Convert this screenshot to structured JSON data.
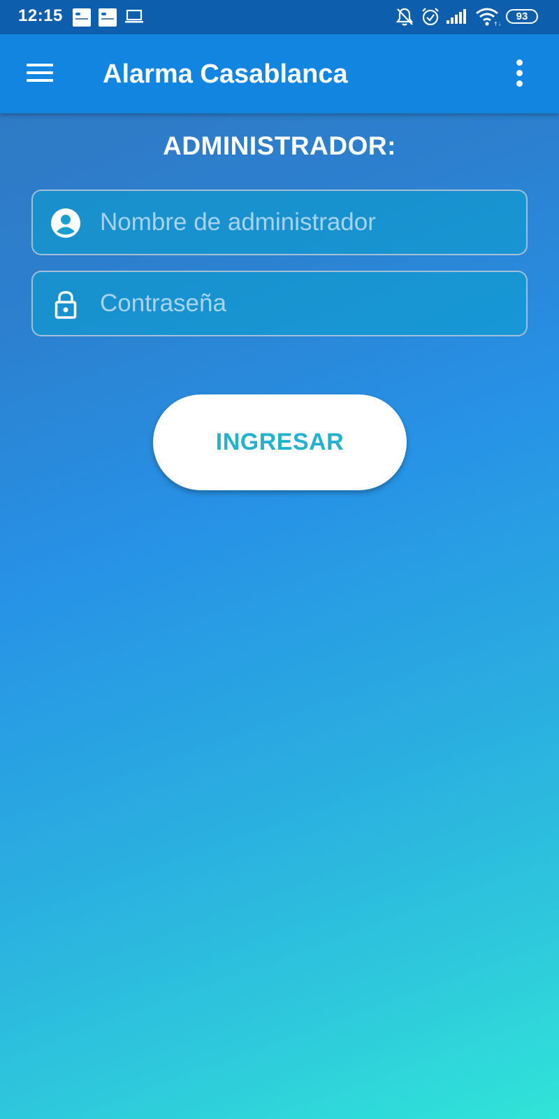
{
  "status_bar": {
    "time": "12:15",
    "battery_level": "93",
    "icons": [
      "app-notification-icon",
      "app-notification-icon",
      "laptop-icon",
      "bell-off-icon",
      "alarm-clock-icon",
      "cell-signal-icon",
      "wifi-icon",
      "battery-icon"
    ]
  },
  "app_bar": {
    "title": "Alarma Casablanca",
    "menu_icon": "hamburger-menu-icon",
    "overflow_icon": "more-vertical-icon",
    "color": "#1285e0"
  },
  "login": {
    "heading": "ADMINISTRADOR:",
    "username_placeholder": "Nombre de administrador",
    "username_value": "",
    "username_icon": "account-circle-icon",
    "password_placeholder": "Contraseña",
    "password_value": "",
    "password_icon": "lock-icon",
    "submit_label": "INGRESAR",
    "submit_text_color": "#22b2cf"
  }
}
